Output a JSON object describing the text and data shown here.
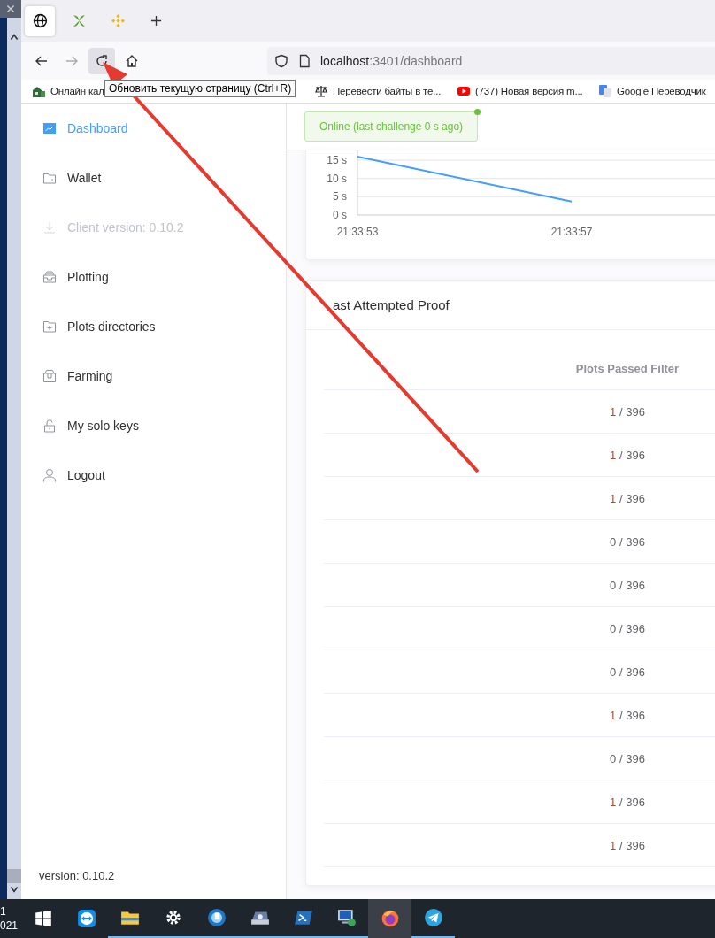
{
  "browser": {
    "tabs": [
      {
        "kind": "globe",
        "selected": true
      },
      {
        "kind": "leaf",
        "selected": false
      },
      {
        "kind": "diamond",
        "selected": false
      }
    ],
    "nav_buttons": [
      {
        "kind": "back",
        "disabled": false,
        "hovered": false
      },
      {
        "kind": "forward",
        "disabled": true,
        "hovered": false
      },
      {
        "kind": "reload",
        "disabled": false,
        "hovered": true
      },
      {
        "kind": "home",
        "disabled": false,
        "hovered": false
      }
    ],
    "url": {
      "host": "localhost",
      "path": ":3401/dashboard"
    },
    "bookmarks": [
      {
        "kind": "building",
        "label": "Онлайн кал"
      },
      {
        "kind": "scales",
        "label": "Перевести байты в те..."
      },
      {
        "kind": "youtube",
        "label": "(737) Новая версия m..."
      },
      {
        "kind": "translate",
        "label": "Google Переводчик"
      }
    ],
    "tooltip": "Обновить текущую страницу (Ctrl+R)"
  },
  "sidebar": {
    "items": [
      {
        "kind": "chart",
        "label": "Dashboard",
        "selected": true,
        "disabled": false
      },
      {
        "kind": "wallet",
        "label": "Wallet",
        "selected": false,
        "disabled": false
      },
      {
        "kind": "download",
        "label": "Client version: 0.10.2",
        "selected": false,
        "disabled": true
      },
      {
        "kind": "tray",
        "label": "Plotting",
        "selected": false,
        "disabled": false
      },
      {
        "kind": "folder-plus",
        "label": "Plots directories",
        "selected": false,
        "disabled": false
      },
      {
        "kind": "box",
        "label": "Farming",
        "selected": false,
        "disabled": false
      },
      {
        "kind": "unlock",
        "label": "My solo keys",
        "selected": false,
        "disabled": false
      },
      {
        "kind": "user",
        "label": "Logout",
        "selected": false,
        "disabled": false
      }
    ],
    "version": "version: 0.10.2"
  },
  "status": {
    "text": "Online (last challenge 0 s ago)",
    "online": true
  },
  "chart": {
    "chart_data": {
      "type": "line",
      "categories": [
        "21:33:53",
        "21:33:57"
      ],
      "series": [
        {
          "color": "#409eff",
          "values": [
            16,
            3.7
          ]
        }
      ],
      "ylim": [
        0,
        17.5
      ],
      "grid": true,
      "yticks": [
        {
          "value": 0,
          "label": "0 s"
        },
        {
          "value": 5,
          "label": "5 s"
        },
        {
          "value": 10,
          "label": "10 s"
        },
        {
          "value": 15,
          "label": "15 s"
        }
      ]
    }
  },
  "proof": {
    "title": "ast Attempted Proof",
    "column": "Plots Passed Filter",
    "rows": [
      {
        "passed": "1",
        "total": "/ 396",
        "highlight": true
      },
      {
        "passed": "1",
        "total": "/ 396",
        "highlight": true
      },
      {
        "passed": "1",
        "total": "/ 396",
        "highlight": true
      },
      {
        "passed": "0",
        "total": "/ 396",
        "highlight": false
      },
      {
        "passed": "0",
        "total": "/ 396",
        "highlight": false
      },
      {
        "passed": "0",
        "total": "/ 396",
        "highlight": false
      },
      {
        "passed": "0",
        "total": "/ 396",
        "highlight": false
      },
      {
        "passed": "1",
        "total": "/ 396",
        "highlight": true
      },
      {
        "passed": "0",
        "total": "/ 396",
        "highlight": false
      },
      {
        "passed": "1",
        "total": "/ 396",
        "highlight": true
      },
      {
        "passed": "1",
        "total": "/ 396",
        "highlight": true
      }
    ]
  },
  "taskbar": {
    "clock_fragments": [
      "1",
      "021"
    ],
    "apps": [
      {
        "kind": "windows",
        "running": false,
        "active": false
      },
      {
        "kind": "teamviewer",
        "running": false,
        "active": false
      },
      {
        "kind": "explorer",
        "running": true,
        "active": false
      },
      {
        "kind": "gear",
        "running": true,
        "active": false
      },
      {
        "kind": "bluecircle",
        "running": true,
        "active": false
      },
      {
        "kind": "scanner",
        "running": true,
        "active": false
      },
      {
        "kind": "powershell",
        "running": true,
        "active": false
      },
      {
        "kind": "remote",
        "running": true,
        "active": false
      },
      {
        "kind": "firefox",
        "running": false,
        "active": true
      },
      {
        "kind": "telegram",
        "running": true,
        "active": false
      }
    ]
  }
}
